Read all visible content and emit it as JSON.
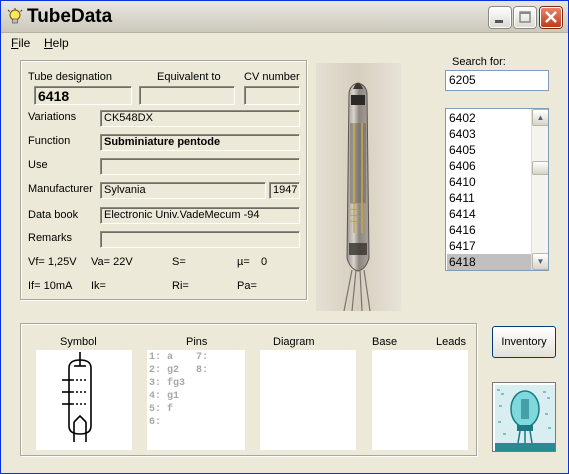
{
  "window": {
    "title": "TubeData"
  },
  "menu": [
    {
      "label": "File"
    },
    {
      "label": "Help"
    }
  ],
  "fields": {
    "tube_designation_label": "Tube designation",
    "tube_designation": "6418",
    "equivalent_label": "Equivalent to",
    "equivalent": "",
    "cv_label": "CV number",
    "cv": "",
    "variations_label": "Variations",
    "variations": "CK548DX",
    "function_label": "Function",
    "function": "Subminiature pentode",
    "use_label": "Use",
    "use": "",
    "manufacturer_label": "Manufacturer",
    "manufacturer": "Sylvania",
    "year": "1947",
    "databook_label": "Data book",
    "databook": "Electronic Univ.VadeMecum -94",
    "remarks_label": "Remarks",
    "remarks": ""
  },
  "params": {
    "vf": "Vf= 1,25V",
    "va": "Va= 22V",
    "s": "S=",
    "mu": "µ=",
    "mu_val": "0",
    "if": "If= 10mA",
    "ik": "Ik=",
    "ri": "Ri=",
    "pa": "Pa="
  },
  "search": {
    "label": "Search for:",
    "value": "6205",
    "items": [
      "6402",
      "6403",
      "6405",
      "6406",
      "6410",
      "6411",
      "6414",
      "6416",
      "6417",
      "6418"
    ],
    "selected": "6418"
  },
  "bottom": {
    "symbol_label": "Symbol",
    "pins_label": "Pins",
    "diagram_label": "Diagram",
    "base_label": "Base",
    "leads_label": "Leads",
    "pins_col1": [
      "1: a",
      "2: g2",
      "3: fg3",
      "4: g1",
      "5: f",
      "6:"
    ],
    "pins_col2": [
      "7:",
      "8:"
    ]
  },
  "buttons": {
    "inventory": "Inventory"
  }
}
